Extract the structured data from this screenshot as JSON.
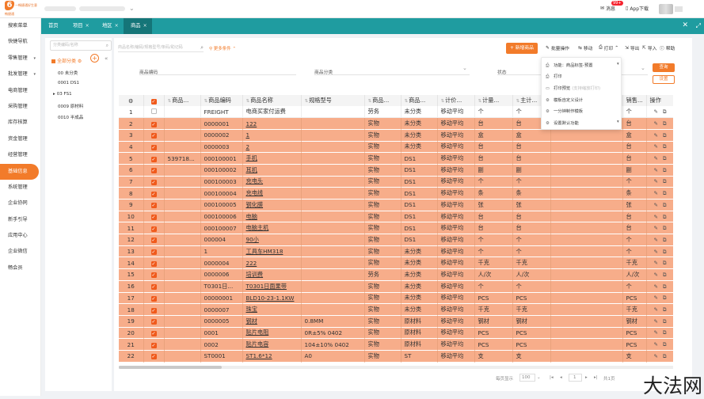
{
  "brand": {
    "logo_letter": "6",
    "tagline": "—畅捷通好生意",
    "name": "畅捷通",
    "accent": "#f27b2a",
    "tabbar_color": "#1f9ca0"
  },
  "header": {
    "msg_label": "消息",
    "msg_badge": "99+",
    "app_label": "App下载"
  },
  "sidebar": {
    "items": [
      {
        "label": "搜索菜单",
        "arrow": ""
      },
      {
        "label": "快捷导航",
        "arrow": ""
      },
      {
        "label": "零售管理",
        "arrow": "▾"
      },
      {
        "label": "批发管理",
        "arrow": "▾"
      },
      {
        "label": "电商管理",
        "arrow": ""
      },
      {
        "label": "采购管理",
        "arrow": ""
      },
      {
        "label": "库存核算",
        "arrow": ""
      },
      {
        "label": "资金管理",
        "arrow": ""
      },
      {
        "label": "经营管理",
        "arrow": ""
      },
      {
        "label": "基础信息",
        "arrow": ""
      },
      {
        "label": "系统管理",
        "arrow": ""
      },
      {
        "label": "企业协同",
        "arrow": ""
      },
      {
        "label": "新手引导",
        "arrow": ""
      },
      {
        "label": "应用中心",
        "arrow": ""
      },
      {
        "label": "企业微信",
        "arrow": ""
      },
      {
        "label": "畅会员",
        "arrow": ""
      }
    ]
  },
  "tabs": [
    {
      "label": "首页",
      "closable": false
    },
    {
      "label": "项目",
      "closable": true
    },
    {
      "label": "地区",
      "closable": true
    },
    {
      "label": "商品",
      "closable": true
    }
  ],
  "tree": {
    "search_placeholder": "分类编码/名称",
    "root": "全部分类",
    "nodes": [
      {
        "label": "00 未分类",
        "caret": ""
      },
      {
        "label": "0001 DS1",
        "caret": ""
      },
      {
        "label": "03 FS1",
        "caret": "▸"
      },
      {
        "label": "0009 原材料",
        "caret": ""
      },
      {
        "label": "0010 半成品",
        "caret": ""
      }
    ]
  },
  "toolbar": {
    "search_placeholder": "商品名称/编码/规格型号/条码/助记码",
    "more_conditions": "更多条件",
    "new_product": "+ 新增商品",
    "batch": "批量操作",
    "move": "移动",
    "print": "打印",
    "export": "导出",
    "import": "导入",
    "help": "帮助"
  },
  "filters": {
    "code_label": "商品编码",
    "category_label": "商品分类",
    "status_label": "状态",
    "query": "查询",
    "reset": "设置"
  },
  "print_menu": {
    "items": [
      {
        "label": "功能：商品标签-预置",
        "hint": ""
      },
      {
        "label": "打印",
        "hint": ""
      },
      {
        "label": "打印预览",
        "hint": "(支持缩放打印)"
      },
      {
        "label": "模板自定义设计",
        "hint": ""
      },
      {
        "label": "一分钟制作模板",
        "hint": ""
      },
      {
        "label": "设置默认功能",
        "hint": ""
      }
    ]
  },
  "table": {
    "columns": [
      "",
      "",
      "商品...",
      "商品编码",
      "商品名称",
      "规格型号",
      "商品...",
      "商品...",
      "计价...",
      "计量...",
      "主计...",
      "",
      "销售...",
      "操作"
    ],
    "rows": [
      [
        "1",
        "FREIGHT",
        "",
        "电商买家付运费",
        "",
        "劳务",
        "未分类",
        "移动平均",
        "个",
        "个",
        "个"
      ],
      [
        "2",
        "0000001",
        "",
        "122",
        "",
        "实物",
        "未分类",
        "移动平均",
        "台",
        "台",
        "台"
      ],
      [
        "3",
        "0000002",
        "",
        "1",
        "",
        "实物",
        "未分类",
        "移动平均",
        "盒",
        "盒",
        "盒"
      ],
      [
        "4",
        "0000003",
        "",
        "2",
        "",
        "实物",
        "未分类",
        "移动平均",
        "台",
        "台",
        "台"
      ],
      [
        "5",
        "000100001",
        "539718...",
        "手机",
        "",
        "实物",
        "DS1",
        "移动平均",
        "台",
        "台",
        "台"
      ],
      [
        "6",
        "000100002",
        "",
        "耳机",
        "",
        "实物",
        "DS1",
        "移动平均",
        "副",
        "副",
        "副"
      ],
      [
        "7",
        "000100003",
        "",
        "充电头",
        "",
        "实物",
        "DS1",
        "移动平均",
        "个",
        "个",
        "个"
      ],
      [
        "8",
        "000100004",
        "",
        "充电线",
        "",
        "实物",
        "DS1",
        "移动平均",
        "条",
        "条",
        "条"
      ],
      [
        "9",
        "000100005",
        "",
        "钢化膜",
        "",
        "实物",
        "DS1",
        "移动平均",
        "张",
        "张",
        "张"
      ],
      [
        "10",
        "000100006",
        "",
        "电脑",
        "",
        "实物",
        "DS1",
        "移动平均",
        "台",
        "台",
        "台"
      ],
      [
        "11",
        "000100007",
        "",
        "电脑主机",
        "",
        "实物",
        "DS1",
        "移动平均",
        "台",
        "台",
        "台"
      ],
      [
        "12",
        "000004",
        "",
        "90小",
        "",
        "实物",
        "DS1",
        "移动平均",
        "个",
        "个",
        "个"
      ],
      [
        "13",
        "1",
        "",
        "工具车HM318",
        "",
        "实物",
        "未分类",
        "移动平均",
        "个",
        "个",
        "个"
      ],
      [
        "14",
        "0000004",
        "",
        "222",
        "",
        "实物",
        "未分类",
        "移动平均",
        "千克",
        "千克",
        "千克"
      ],
      [
        "15",
        "0000006",
        "",
        "培训费",
        "",
        "劳务",
        "未分类",
        "移动平均",
        "人/次",
        "人/次",
        "人/次"
      ],
      [
        "16",
        "T0301日...",
        "",
        "T0301日面果带",
        "",
        "实物",
        "未分类",
        "移动平均",
        "个",
        "个",
        "个"
      ],
      [
        "17",
        "00000001",
        "",
        "BLD10-23-1.1KW",
        "",
        "实物",
        "未分类",
        "移动平均",
        "PCS",
        "PCS",
        "PCS"
      ],
      [
        "18",
        "0000007",
        "",
        "珠宝",
        "",
        "实物",
        "未分类",
        "移动平均",
        "千克",
        "千克",
        "千克"
      ],
      [
        "19",
        "0000005",
        "",
        "钢材",
        "0.8MM",
        "实物",
        "原材料",
        "移动平均",
        "钢材",
        "钢材",
        "钢材"
      ],
      [
        "20",
        "0001",
        "",
        "贴片电阻",
        "0R±5% 0402",
        "实物",
        "原材料",
        "移动平均",
        "PCS",
        "PCS",
        "PCS"
      ],
      [
        "21",
        "0002",
        "",
        "贴片电容",
        "104±10% 0402",
        "实物",
        "原材料",
        "移动平均",
        "PCS",
        "PCS",
        "PCS"
      ],
      [
        "22",
        "ST0001",
        "",
        "ST1.6*12",
        "A0",
        "实物",
        "ST",
        "移动平均",
        "支",
        "支",
        "支"
      ]
    ],
    "plain_rows": [
      1
    ],
    "underline_rows": [
      2,
      3,
      4,
      5,
      6,
      7,
      8,
      9,
      10,
      11,
      12,
      13,
      14,
      15,
      16,
      17,
      18,
      19,
      20,
      21,
      22
    ]
  },
  "pager": {
    "per_page_label": "每页显示",
    "per_page": "100",
    "page": "1",
    "total": "共1页"
  },
  "watermark": "大法网"
}
